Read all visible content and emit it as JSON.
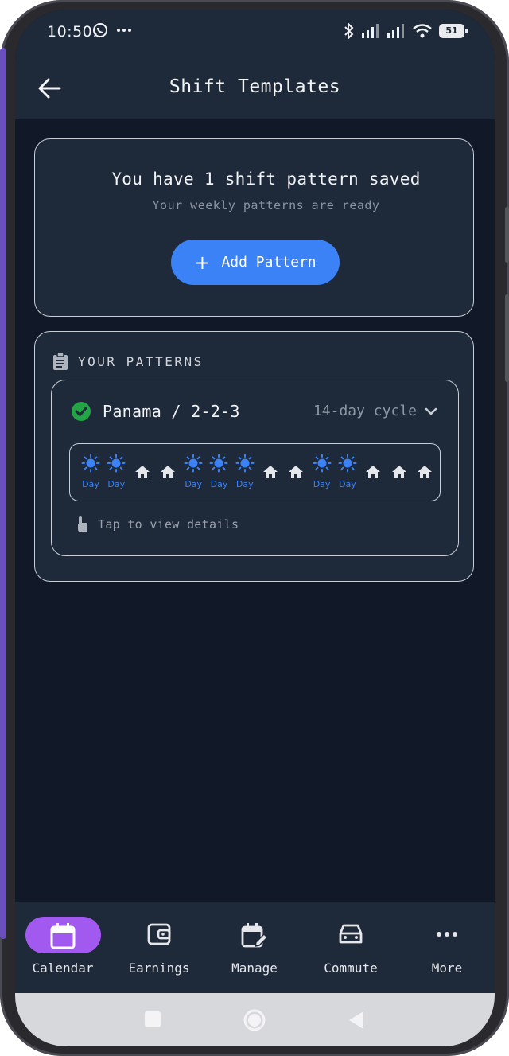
{
  "status_bar": {
    "time": "10:50",
    "battery": "51"
  },
  "app_bar": {
    "title": "Shift Templates"
  },
  "summary": {
    "title": "You have 1 shift pattern saved",
    "subtitle": "Your weekly patterns are ready",
    "add_button_label": "Add Pattern"
  },
  "patterns": {
    "section_title": "YOUR PATTERNS",
    "items": [
      {
        "name": "Panama / 2-2-3",
        "cycle": "14-day cycle",
        "days": [
          "Day",
          "Day",
          "",
          "",
          "Day",
          "Day",
          "Day",
          "",
          "",
          "Day",
          "Day",
          "",
          "",
          ""
        ],
        "hint": "Tap to view details"
      }
    ]
  },
  "bottom_nav": {
    "items": [
      {
        "label": "Calendar",
        "icon": "calendar-icon",
        "active": true
      },
      {
        "label": "Earnings",
        "icon": "wallet-icon",
        "active": false
      },
      {
        "label": "Manage",
        "icon": "calendar-edit-icon",
        "active": false
      },
      {
        "label": "Commute",
        "icon": "car-icon",
        "active": false
      },
      {
        "label": "More",
        "icon": "more-icon",
        "active": false
      }
    ]
  },
  "colors": {
    "background": "#111827",
    "surface": "#1e2939",
    "accent_blue": "#3b82f6",
    "accent_purple": "#a259f0",
    "success_green": "#22a447"
  }
}
